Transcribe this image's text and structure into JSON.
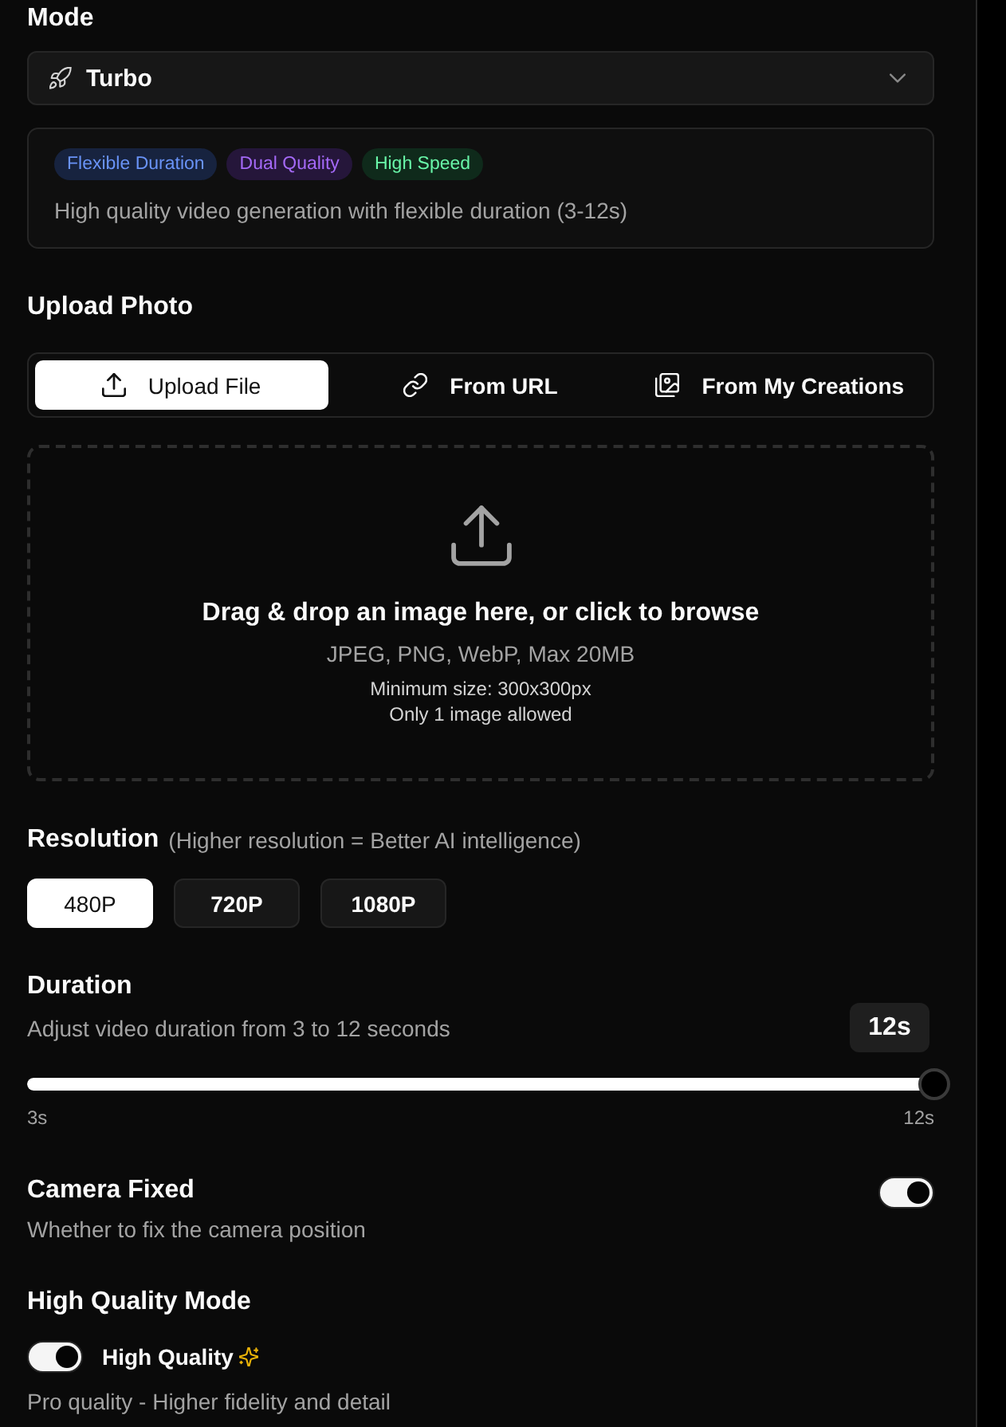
{
  "mode": {
    "label": "Mode",
    "value": "Turbo",
    "tags": [
      {
        "label": "Flexible Duration",
        "color": "#17233f"
      },
      {
        "label": "Dual Quality",
        "color": "#25163a"
      },
      {
        "label": "High Speed",
        "color": "#0f2a1b"
      }
    ],
    "description": "High quality video generation with flexible duration (3-12s)"
  },
  "upload": {
    "label": "Upload Photo",
    "tabs": [
      {
        "label": "Upload File",
        "selected": true
      },
      {
        "label": "From URL",
        "selected": false
      },
      {
        "label": "From My Creations",
        "selected": false
      }
    ],
    "dropzone": {
      "title": "Drag & drop an image here, or click to browse",
      "formats": "JPEG, PNG, WebP, Max 20MB",
      "min_size": "Minimum size: 300x300px",
      "limit": "Only 1 image allowed"
    }
  },
  "resolution": {
    "label": "Resolution",
    "hint": "(Higher resolution = Better AI intelligence)",
    "options": [
      {
        "label": "480P",
        "selected": true
      },
      {
        "label": "720P",
        "selected": false
      },
      {
        "label": "1080P",
        "selected": false
      }
    ]
  },
  "duration": {
    "label": "Duration",
    "description": "Adjust video duration from 3 to 12 seconds",
    "value": "12s",
    "level": 1,
    "min_label": "3s",
    "max_label": "12s"
  },
  "camera_fixed": {
    "label": "Camera Fixed",
    "description": "Whether to fix the camera position",
    "on": true
  },
  "high_quality": {
    "label": "High Quality Mode",
    "toggle_label": "High Quality",
    "on": true,
    "description": "Pro quality - Higher fidelity and detail"
  }
}
